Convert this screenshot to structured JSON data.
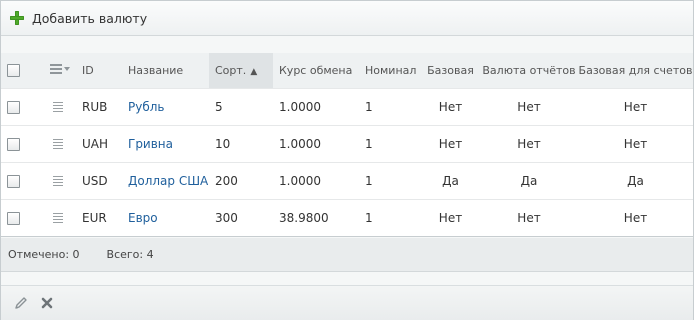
{
  "toolbar": {
    "add_label": "Добавить валюту"
  },
  "table": {
    "columns": [
      {
        "key": "id",
        "label": "ID"
      },
      {
        "key": "name",
        "label": "Название"
      },
      {
        "key": "sort",
        "label": "Сорт."
      },
      {
        "key": "rate",
        "label": "Курс обмена"
      },
      {
        "key": "nominal",
        "label": "Номинал"
      },
      {
        "key": "base",
        "label": "Базовая"
      },
      {
        "key": "report",
        "label": "Валюта отчётов"
      },
      {
        "key": "invoice",
        "label": "Базовая для счетов"
      }
    ],
    "sort_indicator": "▲",
    "rows": [
      {
        "id": "RUB",
        "name": "Рубль",
        "sort": "5",
        "rate": "1.0000",
        "nominal": "1",
        "base": "Нет",
        "report": "Нет",
        "invoice": "Нет"
      },
      {
        "id": "UAH",
        "name": "Гривна",
        "sort": "10",
        "rate": "1.0000",
        "nominal": "1",
        "base": "Нет",
        "report": "Нет",
        "invoice": "Нет"
      },
      {
        "id": "USD",
        "name": "Доллар США",
        "sort": "200",
        "rate": "1.0000",
        "nominal": "1",
        "base": "Да",
        "report": "Да",
        "invoice": "Да"
      },
      {
        "id": "EUR",
        "name": "Евро",
        "sort": "300",
        "rate": "38.9800",
        "nominal": "1",
        "base": "Нет",
        "report": "Нет",
        "invoice": "Нет"
      }
    ]
  },
  "status": {
    "selected": "Отмечено: 0",
    "total": "Всего: 4"
  },
  "icons": {
    "add": "plus-icon",
    "edit": "pencil-icon",
    "delete": "cross-icon",
    "row_menu": "menu-lines-icon"
  }
}
